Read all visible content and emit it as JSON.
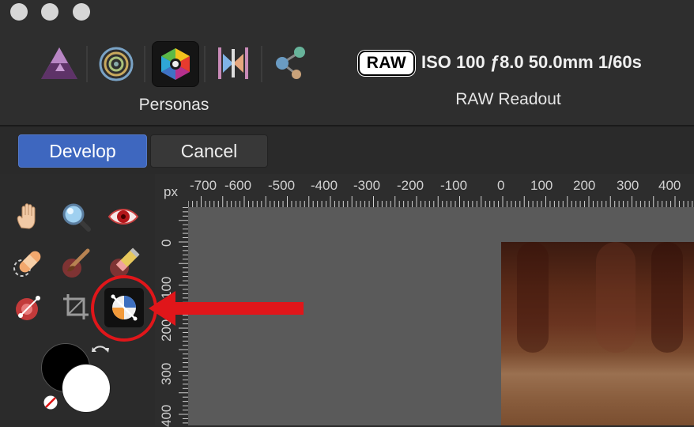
{
  "window": {
    "traffic_lights": [
      "close",
      "minimize",
      "zoom"
    ]
  },
  "personas": {
    "label": "Personas",
    "items": [
      {
        "name": "photo-persona",
        "icon": "affinity-photo-icon"
      },
      {
        "name": "liquify-persona",
        "icon": "liquify-persona-icon"
      },
      {
        "name": "develop-persona",
        "icon": "develop-persona-icon",
        "active": true
      },
      {
        "name": "tone-mapping-persona",
        "icon": "tone-mapping-persona-icon"
      },
      {
        "name": "export-persona",
        "icon": "export-persona-icon"
      }
    ]
  },
  "raw_readout": {
    "badge": "RAW",
    "exif": "ISO 100 ƒ8.0 50.0mm 1/60s",
    "label": "RAW Readout"
  },
  "actions": {
    "develop_label": "Develop",
    "cancel_label": "Cancel"
  },
  "tools": [
    {
      "name": "view-tool",
      "icon": "hand-icon"
    },
    {
      "name": "zoom-tool",
      "icon": "magnifier-icon"
    },
    {
      "name": "red-eye-tool",
      "icon": "red-eye-icon"
    },
    {
      "name": "blemish-removal-tool",
      "icon": "bandage-icon"
    },
    {
      "name": "overlay-paint-tool",
      "icon": "paint-brush-icon"
    },
    {
      "name": "overlay-erase-tool",
      "icon": "eraser-icon"
    },
    {
      "name": "overlay-gradient-tool",
      "icon": "gradient-icon"
    },
    {
      "name": "crop-tool",
      "icon": "crop-icon"
    },
    {
      "name": "white-balance-tool",
      "icon": "white-balance-icon",
      "active": true
    }
  ],
  "colors": {
    "primary": "#000000",
    "secondary": "#ffffff",
    "accent": "#3e67bf",
    "highlight_ring": "#e0161a"
  },
  "ruler": {
    "unit": "px",
    "top_labels": [
      "-700",
      "-600",
      "-500",
      "-400",
      "-300",
      "-200",
      "-100",
      "0",
      "100",
      "200",
      "300",
      "400"
    ],
    "left_labels": [
      "0",
      "100",
      "200",
      "300",
      "400"
    ]
  }
}
